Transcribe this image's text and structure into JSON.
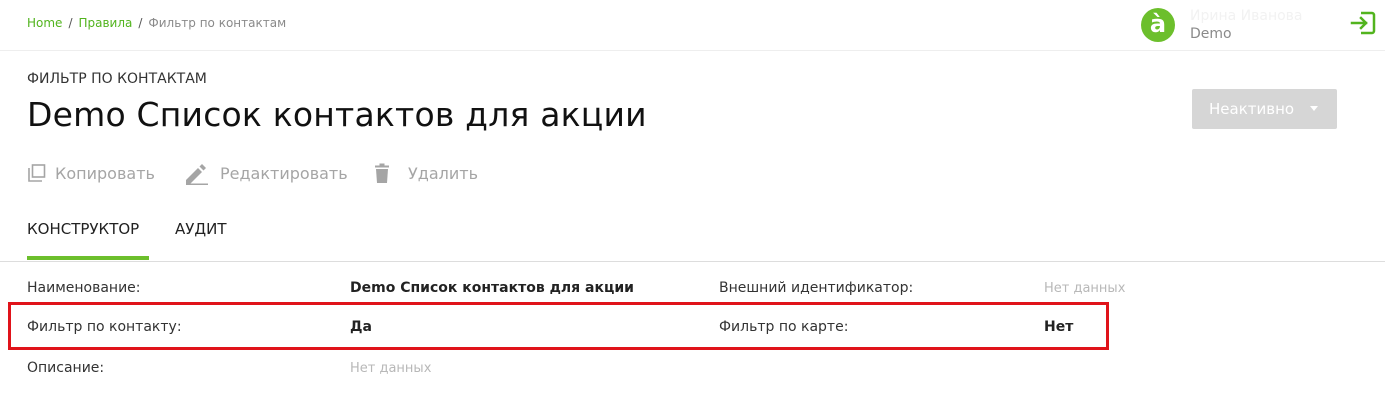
{
  "breadcrumb": {
    "home": "Home",
    "rules": "Правила",
    "current": "Фильтр по контактам"
  },
  "user": {
    "avatar_letter": "à",
    "name": "Ирина Иванова",
    "org": "Demo"
  },
  "page": {
    "subtitle": "ФИЛЬТР ПО КОНТАКТАМ",
    "title": "Demo Список контактов для акции"
  },
  "status": {
    "label": "Неактивно"
  },
  "actions": {
    "copy": "Копировать",
    "edit": "Редактировать",
    "delete": "Удалить"
  },
  "tabs": [
    {
      "label": "КОНСТРУКТОР",
      "active": true
    },
    {
      "label": "АУДИТ",
      "active": false
    }
  ],
  "details": {
    "name_label": "Наименование:",
    "name_value": "Demo Список контактов для акции",
    "ext_id_label": "Внешний идентификатор:",
    "ext_id_value": "Нет данных",
    "contact_filter_label": "Фильтр по контакту:",
    "contact_filter_value": "Да",
    "card_filter_label": "Фильтр по карте:",
    "card_filter_value": "Нет",
    "description_label": "Описание:",
    "description_value": "Нет данных"
  },
  "colors": {
    "accent": "#6cbf2c",
    "link": "#52b41e",
    "highlight": "#e0131a"
  }
}
